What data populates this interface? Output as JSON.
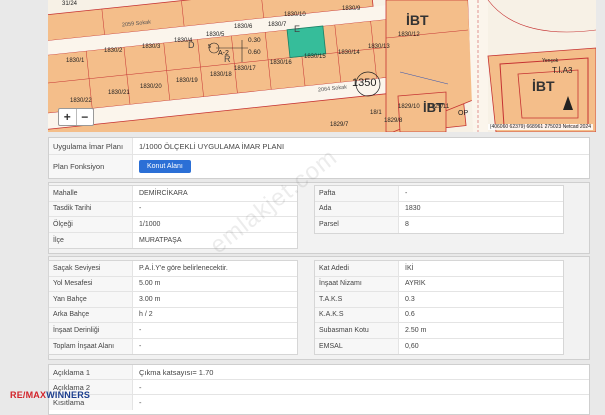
{
  "map": {
    "road_labels": [
      "2059 Sokak",
      "2064 Sokak"
    ],
    "parcels": [
      "31/24",
      "1830/10",
      "1830/9",
      "1830/12",
      "1830/6",
      "1830/7",
      "1830/4",
      "1830/5",
      "1830/3",
      "1830/2",
      "1830/1",
      "1830/16",
      "1830/15",
      "1830/14",
      "1830/13",
      "1830/20",
      "1830/19",
      "1830/18",
      "1830/17",
      "1830/21",
      "1830/22",
      "1829/8",
      "1829/7",
      "1829/10",
      "1829/11",
      "18/1"
    ],
    "zone_code": "A-2",
    "zone_ratio_top": "0.30",
    "zone_ratio_bottom": "0.60",
    "zone_index": "5",
    "block_number": "1350",
    "ibt_labels": [
      "İBT",
      "İBT",
      "İBT"
    ],
    "tia_label": "T.İ.A3",
    "yencok_label": "Yençok",
    "op_label": "OP",
    "street_letters": [
      "D",
      "R",
      "E"
    ],
    "footer": "(406060 62379) 668961 275023 Netcad 2024",
    "zoom_in": "+",
    "zoom_out": "−"
  },
  "info": {
    "plan_label": "Uygulama İmar Planı",
    "plan_value": "1/1000 ÖLÇEKLİ UYGULAMA İMAR PLANI",
    "function_label": "Plan Fonksiyon",
    "function_button": "Konut Alanı"
  },
  "location": {
    "left": [
      {
        "label": "Mahalle",
        "value": "DEMİRCİKARA"
      },
      {
        "label": "Tasdik Tarihi",
        "value": "-"
      },
      {
        "label": "Ölçeği",
        "value": "1/1000"
      },
      {
        "label": "İlçe",
        "value": "MURATPAŞA"
      }
    ],
    "right": [
      {
        "label": "Pafta",
        "value": "-"
      },
      {
        "label": "Ada",
        "value": "1830"
      },
      {
        "label": "Parsel",
        "value": "8"
      }
    ]
  },
  "building": {
    "left": [
      {
        "label": "Saçak Seviyesi",
        "value": "P.A.İ.Y'e göre belirlenecektir."
      },
      {
        "label": "Yol Mesafesi",
        "value": "5.00 m"
      },
      {
        "label": "Yan Bahçe",
        "value": "3.00 m"
      },
      {
        "label": "Arka Bahçe",
        "value": "h / 2"
      },
      {
        "label": "İnşaat Derinliği",
        "value": "-"
      },
      {
        "label": "Toplam İnşaat Alanı",
        "value": "-"
      }
    ],
    "right": [
      {
        "label": "Kat Adedi",
        "value": "İKİ"
      },
      {
        "label": "İnşaat Nizamı",
        "value": "AYRIK"
      },
      {
        "label": "T.A.K.S",
        "value": "0.3"
      },
      {
        "label": "K.A.K.S",
        "value": "0.6"
      },
      {
        "label": "Subasman Kotu",
        "value": "2.50 m"
      },
      {
        "label": "EMSAL",
        "value": "0,60"
      }
    ]
  },
  "notes": [
    {
      "label": "Açıklama 1",
      "value": "Çıkma katsayısı= 1.70"
    },
    {
      "label": "Açıklama 2",
      "value": "-"
    },
    {
      "label": "Kısıtlama",
      "value": "-"
    }
  ],
  "watermark": "emlakjet.com",
  "brand": {
    "red": "RE/MAX",
    "blue": "WINNERS"
  },
  "colors": {
    "parcel": "#f4be8a",
    "road": "#fbf5ec",
    "border": "#c53232",
    "highlight": "#36bd9a",
    "button": "#2b6fd6"
  }
}
